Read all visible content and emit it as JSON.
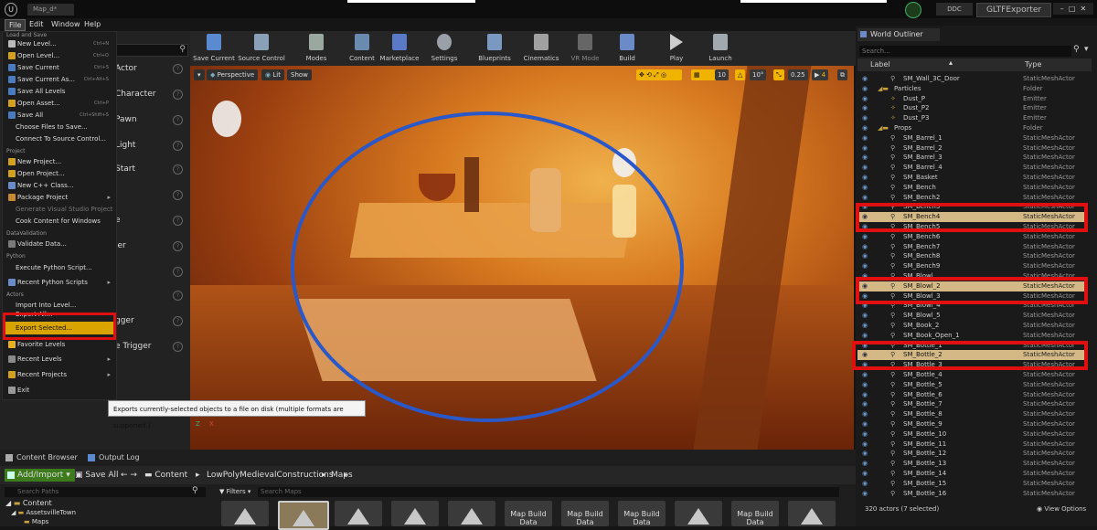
{
  "window": {
    "doc_tab": "Map_d*",
    "menus": [
      "File",
      "Edit",
      "Window",
      "Help"
    ],
    "ddc_label": "DDC",
    "plugin_label": "GLTFExporter"
  },
  "file_menu": {
    "sections": {
      "load_save": "Load and Save",
      "project": "Project",
      "data_validation": "DataValidation",
      "python": "Python",
      "actors": "Actors"
    },
    "items": {
      "new_level": {
        "label": "New Level...",
        "shortcut": "Ctrl+N"
      },
      "open_level": {
        "label": "Open Level...",
        "shortcut": "Ctrl+O"
      },
      "save_current": {
        "label": "Save Current",
        "shortcut": "Ctrl+S"
      },
      "save_current_as": {
        "label": "Save Current As...",
        "shortcut": "Ctrl+Alt+S"
      },
      "save_all_levels": {
        "label": "Save All Levels"
      },
      "open_asset": {
        "label": "Open Asset...",
        "shortcut": "Ctrl+P"
      },
      "save_all": {
        "label": "Save All",
        "shortcut": "Ctrl+Shift+S"
      },
      "choose_files": {
        "label": "Choose Files to Save..."
      },
      "connect_source": {
        "label": "Connect To Source Control..."
      },
      "new_project": {
        "label": "New Project..."
      },
      "open_project": {
        "label": "Open Project..."
      },
      "new_cpp_class": {
        "label": "New C++ Class..."
      },
      "package_project": {
        "label": "Package Project"
      },
      "gen_vs_project": {
        "label": "Generate Visual Studio Project"
      },
      "cook_windows": {
        "label": "Cook Content for Windows"
      },
      "validate_data": {
        "label": "Validate Data..."
      },
      "exec_python": {
        "label": "Execute Python Script..."
      },
      "recent_python": {
        "label": "Recent Python Scripts"
      },
      "import_level": {
        "label": "Import Into Level..."
      },
      "export_all": {
        "label": "Export All..."
      },
      "export_selected": {
        "label": "Export Selected..."
      },
      "favorite_levels": {
        "label": "Favorite Levels"
      },
      "recent_levels": {
        "label": "Recent Levels"
      },
      "recent_projects": {
        "label": "Recent Projects"
      },
      "exit": {
        "label": "Exit"
      }
    },
    "tooltip": "Exports currently-selected objects to a file on disk (multiple formats are supported.)"
  },
  "place_actors": {
    "items": [
      "Actor",
      "Character",
      "Pawn",
      "Light",
      "Start",
      "e",
      "ler",
      "",
      "",
      "gger",
      "e Trigger"
    ]
  },
  "toolbar": {
    "buttons": [
      "Save Current",
      "Source Control",
      "Modes",
      "Content",
      "Marketplace",
      "Settings",
      "Blueprints",
      "Cinematics",
      "VR Mode",
      "Build",
      "Play",
      "Launch"
    ]
  },
  "viewport": {
    "perspective": "Perspective",
    "lit": "Lit",
    "show": "Show",
    "grid_snap": "10",
    "rot_snap": "10°",
    "scale_snap": "0.25",
    "cam_speed": "4",
    "axis_z": "Z",
    "axis_x": "X"
  },
  "outliner": {
    "title": "World Outliner",
    "search_placeholder": "Search...",
    "col_label": "Label",
    "col_type": "Type",
    "rows": [
      {
        "name": "SM_Wall_3C_Door",
        "type": "StaticMeshActor",
        "indent": 2,
        "kind": "mesh"
      },
      {
        "name": "Particles",
        "type": "Folder",
        "indent": 1,
        "kind": "folder"
      },
      {
        "name": "Dust_P",
        "type": "Emitter",
        "indent": 2,
        "kind": "emitter"
      },
      {
        "name": "Dust_P2",
        "type": "Emitter",
        "indent": 2,
        "kind": "emitter"
      },
      {
        "name": "Dust_P3",
        "type": "Emitter",
        "indent": 2,
        "kind": "emitter"
      },
      {
        "name": "Props",
        "type": "Folder",
        "indent": 1,
        "kind": "folder"
      },
      {
        "name": "SM_Barrel_1",
        "type": "StaticMeshActor",
        "indent": 2,
        "kind": "mesh"
      },
      {
        "name": "SM_Barrel_2",
        "type": "StaticMeshActor",
        "indent": 2,
        "kind": "mesh"
      },
      {
        "name": "SM_Barrel_3",
        "type": "StaticMeshActor",
        "indent": 2,
        "kind": "mesh"
      },
      {
        "name": "SM_Barrel_4",
        "type": "StaticMeshActor",
        "indent": 2,
        "kind": "mesh"
      },
      {
        "name": "SM_Basket",
        "type": "StaticMeshActor",
        "indent": 2,
        "kind": "mesh"
      },
      {
        "name": "SM_Bench",
        "type": "StaticMeshActor",
        "indent": 2,
        "kind": "mesh"
      },
      {
        "name": "SM_Bench2",
        "type": "StaticMeshActor",
        "indent": 2,
        "kind": "mesh"
      },
      {
        "name": "SM_Bench3",
        "type": "StaticMeshActor",
        "indent": 2,
        "kind": "mesh"
      },
      {
        "name": "SM_Bench4",
        "type": "StaticMeshActor",
        "indent": 2,
        "kind": "mesh",
        "selected": true
      },
      {
        "name": "SM_Bench5",
        "type": "StaticMeshActor",
        "indent": 2,
        "kind": "mesh"
      },
      {
        "name": "SM_Bench6",
        "type": "StaticMeshActor",
        "indent": 2,
        "kind": "mesh"
      },
      {
        "name": "SM_Bench7",
        "type": "StaticMeshActor",
        "indent": 2,
        "kind": "mesh"
      },
      {
        "name": "SM_Bench8",
        "type": "StaticMeshActor",
        "indent": 2,
        "kind": "mesh"
      },
      {
        "name": "SM_Bench9",
        "type": "StaticMeshActor",
        "indent": 2,
        "kind": "mesh"
      },
      {
        "name": "SM_Blowl",
        "type": "StaticMeshActor",
        "indent": 2,
        "kind": "mesh"
      },
      {
        "name": "SM_Blowl_2",
        "type": "StaticMeshActor",
        "indent": 2,
        "kind": "mesh",
        "selected": true
      },
      {
        "name": "SM_Blowl_3",
        "type": "StaticMeshActor",
        "indent": 2,
        "kind": "mesh"
      },
      {
        "name": "SM_Blowl_4",
        "type": "StaticMeshActor",
        "indent": 2,
        "kind": "mesh"
      },
      {
        "name": "SM_Blowl_5",
        "type": "StaticMeshActor",
        "indent": 2,
        "kind": "mesh"
      },
      {
        "name": "SM_Book_2",
        "type": "StaticMeshActor",
        "indent": 2,
        "kind": "mesh"
      },
      {
        "name": "SM_Book_Open_1",
        "type": "StaticMeshActor",
        "indent": 2,
        "kind": "mesh"
      },
      {
        "name": "SM_Bottle_1",
        "type": "StaticMeshActor",
        "indent": 2,
        "kind": "mesh"
      },
      {
        "name": "SM_Bottle_2",
        "type": "StaticMeshActor",
        "indent": 2,
        "kind": "mesh",
        "selected": true
      },
      {
        "name": "SM_Bottle_3",
        "type": "StaticMeshActor",
        "indent": 2,
        "kind": "mesh"
      },
      {
        "name": "SM_Bottle_4",
        "type": "StaticMeshActor",
        "indent": 2,
        "kind": "mesh"
      },
      {
        "name": "SM_Bottle_5",
        "type": "StaticMeshActor",
        "indent": 2,
        "kind": "mesh"
      },
      {
        "name": "SM_Bottle_6",
        "type": "StaticMeshActor",
        "indent": 2,
        "kind": "mesh"
      },
      {
        "name": "SM_Bottle_7",
        "type": "StaticMeshActor",
        "indent": 2,
        "kind": "mesh"
      },
      {
        "name": "SM_Bottle_8",
        "type": "StaticMeshActor",
        "indent": 2,
        "kind": "mesh"
      },
      {
        "name": "SM_Bottle_9",
        "type": "StaticMeshActor",
        "indent": 2,
        "kind": "mesh"
      },
      {
        "name": "SM_Bottle_10",
        "type": "StaticMeshActor",
        "indent": 2,
        "kind": "mesh"
      },
      {
        "name": "SM_Bottle_11",
        "type": "StaticMeshActor",
        "indent": 2,
        "kind": "mesh"
      },
      {
        "name": "SM_Bottle_12",
        "type": "StaticMeshActor",
        "indent": 2,
        "kind": "mesh"
      },
      {
        "name": "SM_Bottle_13",
        "type": "StaticMeshActor",
        "indent": 2,
        "kind": "mesh"
      },
      {
        "name": "SM_Bottle_14",
        "type": "StaticMeshActor",
        "indent": 2,
        "kind": "mesh"
      },
      {
        "name": "SM_Bottle_15",
        "type": "StaticMeshActor",
        "indent": 2,
        "kind": "mesh"
      },
      {
        "name": "SM_Bottle_16",
        "type": "StaticMeshActor",
        "indent": 2,
        "kind": "mesh"
      }
    ],
    "footer_count": "320 actors (7 selected)",
    "view_options": "View Options"
  },
  "content_browser": {
    "tabs": [
      "Content Browser",
      "Output Log"
    ],
    "add_import": "Add/Import",
    "save_all": "Save All",
    "breadcrumbs": [
      "Content",
      "LowPolyMedievalConstructions",
      "Maps"
    ],
    "search_paths_placeholder": "Search Paths",
    "filters": "Filters",
    "search_maps_placeholder": "Search Maps",
    "tree": [
      "Content",
      "AssetsvilleTown",
      "Maps"
    ],
    "map_build_label": "Map Build Data"
  },
  "colors": {
    "highlight_red": "#e01010",
    "selection_gold": "#d4b986",
    "menu_highlight": "#d9a400",
    "circle_blue": "#2a58c8"
  }
}
